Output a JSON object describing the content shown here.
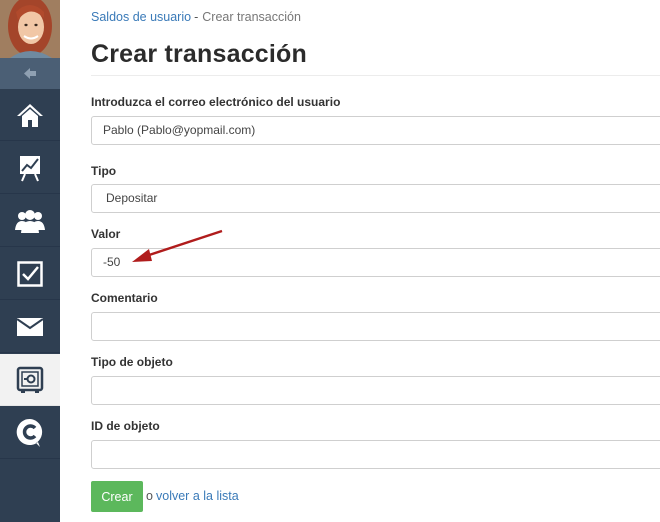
{
  "sidebar": {
    "avatar_icon": "user-avatar",
    "collapse_icon": "collapse-arrow-icon",
    "items": [
      {
        "icon": "home-icon"
      },
      {
        "icon": "chart-icon"
      },
      {
        "icon": "users-icon"
      },
      {
        "icon": "checkbox-icon"
      },
      {
        "icon": "mail-icon"
      },
      {
        "icon": "safe-icon",
        "active": true
      },
      {
        "icon": "c-logo-icon"
      }
    ]
  },
  "breadcrumb": {
    "parent": "Saldos de usuario",
    "separator": "-",
    "current": "Crear transacción"
  },
  "page_title": "Crear transacción",
  "form": {
    "email": {
      "label": "Introduzca el correo electrónico del usuario",
      "value": "Pablo (Pablo@yopmail.com)"
    },
    "type": {
      "label": "Tipo",
      "value": "Depositar"
    },
    "amount": {
      "label": "Valor",
      "value": "-50"
    },
    "comment": {
      "label": "Comentario",
      "value": ""
    },
    "object_type": {
      "label": "Tipo de objeto",
      "value": ""
    },
    "object_id": {
      "label": "ID de objeto",
      "value": ""
    }
  },
  "actions": {
    "create_label": "Crear",
    "or_text": "o",
    "back_label": "volver a la lista"
  },
  "colors": {
    "sidebar": "#2f3f52",
    "link": "#3a7ab8",
    "create_button": "#5cb85c",
    "annotation_arrow": "#b01c1c"
  }
}
